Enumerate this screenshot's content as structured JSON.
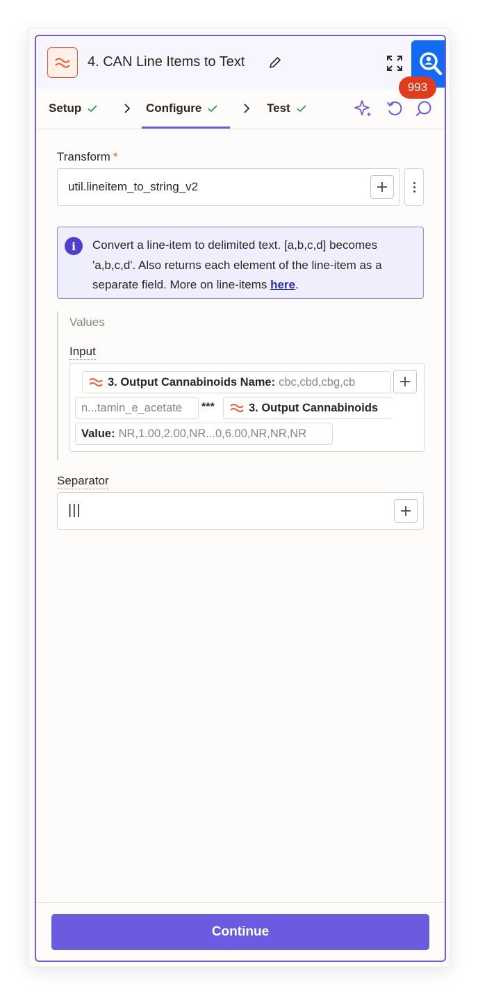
{
  "header": {
    "title": "4. CAN Line Items to Text",
    "notification_count": "993"
  },
  "tabs": [
    {
      "label": "Setup",
      "status": "complete"
    },
    {
      "label": "Configure",
      "status": "complete",
      "active": true
    },
    {
      "label": "Test",
      "status": "complete"
    }
  ],
  "form": {
    "transform": {
      "label": "Transform",
      "required_mark": "*",
      "value": "util.lineitem_to_string_v2"
    },
    "info": {
      "text": "Convert a line-item to delimited text. [a,b,c,d] becomes 'a,b,c,d'. Also returns each element of the line-item as a separate field. More on line-items ",
      "link_text": "here",
      "suffix": "."
    },
    "values_group": {
      "title": "Values",
      "input_label": "Input",
      "pills": [
        {
          "label": "3. Output Cannabinoids Name:",
          "value": "cbc,cbd,cbg,cb"
        },
        {
          "value": "n...tamin_e_acetate"
        },
        {
          "label": "3. Output Cannabinoids"
        },
        {
          "label": "Value:",
          "value": "NR,1.00,2.00,NR...0,6.00,NR,NR,NR"
        }
      ],
      "separator_text": "***"
    },
    "separator": {
      "label": "Separator",
      "value": "|||"
    }
  },
  "footer": {
    "continue_label": "Continue"
  },
  "colors": {
    "accent": "#6a5be0",
    "brand_orange": "#ee5b2a",
    "success": "#2e9a55",
    "badge": "#e23a1c",
    "zoom_button": "#136bf5"
  }
}
